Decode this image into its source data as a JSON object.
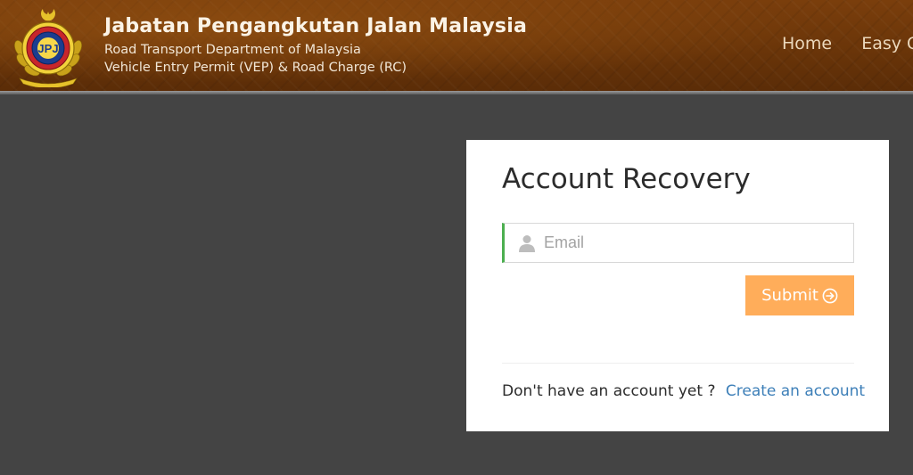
{
  "header": {
    "title": "Jabatan Pengangkutan Jalan Malaysia",
    "subtitle_1": "Road Transport Department of Malaysia",
    "subtitle_2": "Vehicle Entry Permit (VEP) & Road Charge (RC)",
    "logo_icon": "jpj-crest-icon",
    "nav": [
      {
        "label": "Home"
      },
      {
        "label": "Easy G"
      }
    ]
  },
  "form": {
    "title": "Account Recovery",
    "email_placeholder": "Email",
    "email_value": "",
    "email_icon": "user-icon",
    "submit_label": "Submit",
    "submit_icon": "arrow-circle-right-icon",
    "signup_prompt": "Don't have an account yet ?",
    "signup_link": "Create an account"
  },
  "colors": {
    "header_brown": "#6a3509",
    "background": "#444444",
    "submit_orange": "#ffad5a",
    "link_blue": "#3d7fb8",
    "input_accent_green": "#4caf50"
  }
}
